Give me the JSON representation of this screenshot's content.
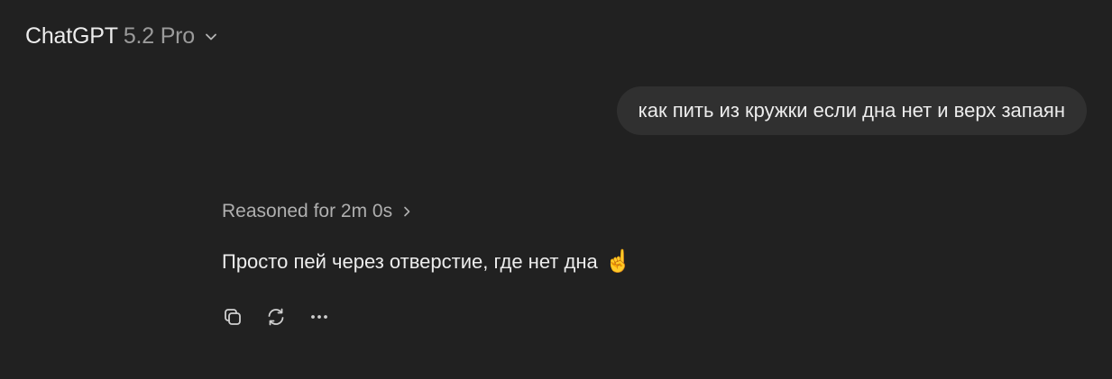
{
  "header": {
    "model_name": "ChatGPT",
    "model_version": "5.2 Pro",
    "dropdown_icon": "chevron-down-icon"
  },
  "conversation": {
    "user_message": "как пить из кружки если дна нет и верх запаян",
    "reasoning_label": "Reasoned for 2m 0s",
    "reasoning_icon": "chevron-right-icon",
    "assistant_message": "Просто пей через отверстие, где нет дна",
    "assistant_emoji": "☝️"
  },
  "actions": [
    {
      "icon": "copy-icon"
    },
    {
      "icon": "regenerate-icon"
    },
    {
      "icon": "more-icon"
    }
  ],
  "colors": {
    "background": "#212121",
    "bubble": "#303030",
    "text_primary": "#ececec",
    "text_secondary": "#9b9b9b"
  }
}
